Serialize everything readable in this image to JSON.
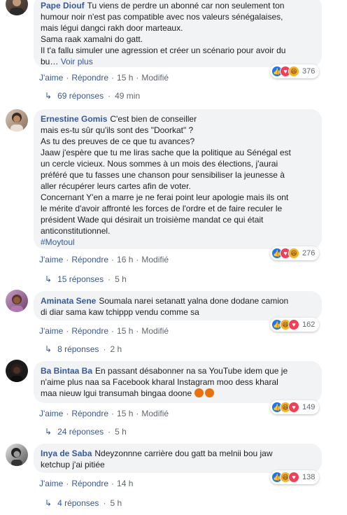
{
  "comments": [
    {
      "author": "Pape Diouf",
      "lines": [
        "Tu viens de perdre un abonné car non seulement ton",
        "humour noir n'est pas compatible avec nos valeurs sénégalaises,",
        "mais légui dangci rakh door marteaux.",
        "Sama raak xamalni do gatt.",
        "Il t'a fallu simuler une agression et créer un scénario pour avoir du",
        "bu…"
      ],
      "see_more": "Voir plus",
      "like": "J'aime",
      "reply": "Répondre",
      "time": "15 h",
      "edited": "Modifié",
      "reaction_count": "376",
      "reaction_icons": [
        "like-icon",
        "love-icon",
        "haha-icon"
      ],
      "replies_label": "69 réponses",
      "replies_time": "49 min"
    },
    {
      "author": "Ernestine Gomis",
      "lines": [
        "C'est bien de conseiller",
        "mais es-tu sûr qu'ils sont des \"Doorkat\" ?",
        "As tu des preuves de ce que tu avances?",
        "Jaaw j'espère que tu me liras sache que la politique au Sénégal est",
        "un cercle vicieux. Nous sommes à un mois des élections, j'aurai",
        "préféré que tu fasses une chanson pour sensibiliser la jeunesse à",
        "aller récupérer leurs cartes afin de voter.",
        "Concernant Y'en a marre je ne ferai point leur apologie mais ils ont",
        "le mérite d'avoir affronté les forces de l'ordre et de faire reculer le",
        "président Wade qui désirait un troisième mandat ce qui était",
        "anticonstitutionnel."
      ],
      "hashtag": "#Moytoul",
      "like": "J'aime",
      "reply": "Répondre",
      "time": "16 h",
      "edited": "Modifié",
      "reaction_count": "276",
      "reaction_icons": [
        "like-icon",
        "love-icon",
        "haha-icon"
      ],
      "replies_label": "15 réponses",
      "replies_time": "5 h"
    },
    {
      "author": "Aminata Sene",
      "lines": [
        "Soumala narei setanatt yalna done dodane camion",
        "di diar sama kaw tchippp vendu comme sa"
      ],
      "like": "J'aime",
      "reply": "Répondre",
      "time": "15 h",
      "edited": "Modifié",
      "reaction_count": "162",
      "reaction_icons": [
        "like-icon",
        "haha-icon",
        "love-icon"
      ],
      "replies_label": "8 réponses",
      "replies_time": "2 h"
    },
    {
      "author": "Ba Bintaa Ba",
      "lines": [
        "En passant désabonner na sa YouTube idem que je",
        "n'aime plus naa sa Facebook kharal Instagram moo dess kharal",
        "maa nieuw lgui transumah bingaa doone"
      ],
      "like": "J'aime",
      "reply": "Répondre",
      "time": "15 h",
      "edited": "Modifié",
      "reaction_count": "149",
      "reaction_icons": [
        "like-icon",
        "haha-icon",
        "love-icon"
      ],
      "replies_label": "24 réponses",
      "replies_time": "5 h"
    },
    {
      "author": "Inya de Saba",
      "lines": [
        "Ndeyzonnne carrière dou gatt ba melnii bou jaw",
        "ketchup j'ai pitiée"
      ],
      "like": "J'aime",
      "reply": "Répondre",
      "time": "14 h",
      "reaction_count": "138",
      "reaction_icons": [
        "like-icon",
        "haha-icon",
        "love-icon"
      ],
      "replies_label": "4 réponses",
      "replies_time": "5 h"
    }
  ],
  "colors": {
    "link": "#385898",
    "bubble": "#f2f3f5",
    "meta": "#606770",
    "like": "#1877f2",
    "love": "#f33e58",
    "haha": "#f7b125"
  }
}
